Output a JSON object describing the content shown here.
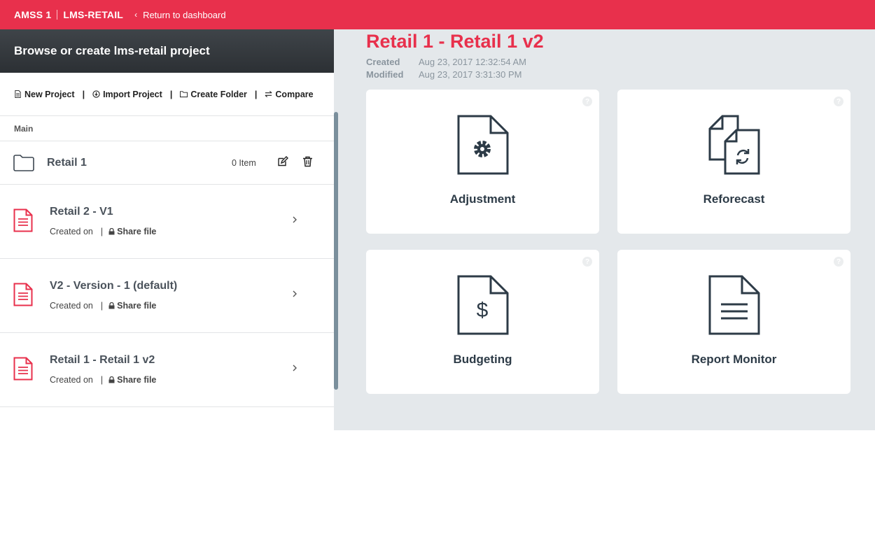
{
  "header": {
    "app_name": "AMSS 1",
    "module": "LMS-RETAIL",
    "back_label": "Return to dashboard",
    "accent": "#e8304c"
  },
  "sidebar": {
    "title": "Browse or create lms-retail project",
    "toolbar": {
      "new_project": "New Project",
      "import_project": "Import Project",
      "create_folder": "Create Folder",
      "compare": "Compare"
    },
    "section": "Main",
    "folder": {
      "name": "Retail 1",
      "count": "0 Item"
    },
    "files": [
      {
        "title": "Retail 2 - V1",
        "created": "Created on",
        "share": "Share file"
      },
      {
        "title": "V2 - Version - 1 (default)",
        "created": "Created on",
        "share": "Share file"
      },
      {
        "title": "Retail 1 - Retail 1 v2",
        "created": "Created on",
        "share": "Share file"
      }
    ]
  },
  "project": {
    "title": "Retail 1 - Retail 1 v2",
    "created_label": "Created",
    "created_value": "Aug 23, 2017 12:32:54 AM",
    "modified_label": "Modified",
    "modified_value": "Aug 23, 2017 3:31:30 PM"
  },
  "cards": [
    {
      "label": "Adjustment",
      "icon": "document-gear-icon"
    },
    {
      "label": "Reforecast",
      "icon": "documents-refresh-icon"
    },
    {
      "label": "Budgeting",
      "icon": "document-dollar-icon"
    },
    {
      "label": "Report Monitor",
      "icon": "document-lines-icon"
    }
  ],
  "help_glyph": "?"
}
